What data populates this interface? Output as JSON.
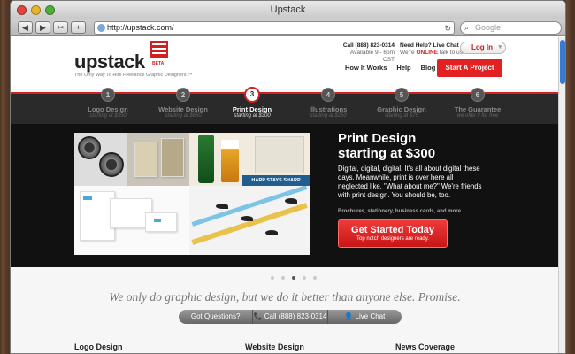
{
  "browser": {
    "window_title": "Upstack",
    "url": "http://upstack.com/",
    "search_placeholder": "Google",
    "nav_buttons": [
      "◀",
      "▶",
      "✂",
      "+"
    ]
  },
  "header": {
    "logo_text": "upstack",
    "beta": "BETA",
    "tagline": "The Only Way To Hire Freelance Graphic Designers.™",
    "phone_line1": "Call (888) 823-0314",
    "phone_line2": "Available 9 - 6pm CST",
    "help_line1": "Need Help? Live Chat",
    "help_line2_prefix": "We're",
    "help_line2_online": "ONLINE",
    "help_line2_suffix": "talk to us!",
    "login_label": "Log In",
    "nav": [
      "How It Works",
      "Help",
      "Blog"
    ],
    "cta_label": "Start A Project"
  },
  "steps": [
    {
      "num": "1",
      "label": "Logo Design",
      "sub": "starting at $350"
    },
    {
      "num": "2",
      "label": "Website Design",
      "sub": "starting at $650"
    },
    {
      "num": "3",
      "label": "Print Design",
      "sub": "starting at $300"
    },
    {
      "num": "4",
      "label": "Illustrations",
      "sub": "starting at $250"
    },
    {
      "num": "5",
      "label": "Graphic Design",
      "sub": "starting at $75"
    },
    {
      "num": "6",
      "label": "The Guarantee",
      "sub": "we offer it for free"
    }
  ],
  "active_step": 3,
  "hero": {
    "title_line1": "Print Design",
    "title_line2": "starting at $300",
    "body": "Digital, digital, digital. It's all about digital these days. Meanwhile, print is over here all neglected like, \"What about me?\" We're friends with print design. You should be, too.",
    "small": "Brochures, stationery, business cards, and more.",
    "btn_big": "Get Started Today",
    "btn_small": "Top notch designers are ready.",
    "harp_text": "HARP STAYS SHARP"
  },
  "carousel_active_dot": 3,
  "promise": "We only do graphic design, but we do it better than anyone else. Promise.",
  "pills": [
    "Got Questions?",
    "📞 Call (888) 823-0314",
    "👤 Live Chat"
  ],
  "footer_cols": [
    "Logo Design",
    "Website Design",
    "News Coverage"
  ],
  "colors": {
    "accent": "#e22222",
    "dark": "#111111"
  }
}
